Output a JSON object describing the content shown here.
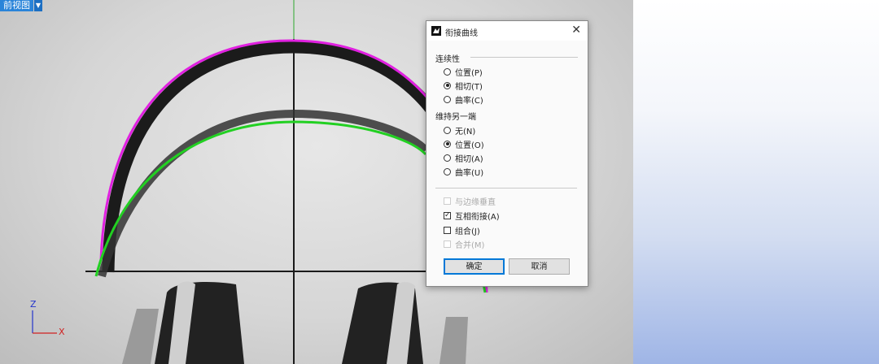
{
  "viewport": {
    "tab_label": "前视图",
    "dropdown_icon": "chevron-down-icon"
  },
  "axes": {
    "z_label": "Z",
    "x_label": "X"
  },
  "dialog": {
    "title": "衔接曲线",
    "close_glyph": "✕",
    "continuity": {
      "label": "连续性",
      "options": [
        {
          "label": "位置(P)",
          "selected": false
        },
        {
          "label": "相切(T)",
          "selected": true
        },
        {
          "label": "曲率(C)",
          "selected": false
        }
      ]
    },
    "maintain_other_end": {
      "label": "维持另一端",
      "options": [
        {
          "label": "无(N)",
          "selected": false
        },
        {
          "label": "位置(O)",
          "selected": true
        },
        {
          "label": "相切(A)",
          "selected": false
        },
        {
          "label": "曲率(U)",
          "selected": false
        }
      ]
    },
    "checkboxes": [
      {
        "label": "与边缘垂直",
        "checked": false,
        "enabled": false
      },
      {
        "label": "互相衔接(A)",
        "checked": true,
        "enabled": true
      },
      {
        "label": "组合(J)",
        "checked": false,
        "enabled": true
      },
      {
        "label": "合并(M)",
        "checked": false,
        "enabled": false
      }
    ],
    "ok_label": "确定",
    "cancel_label": "取消"
  },
  "colors": {
    "magenta_curve": "#e020e0",
    "green_curve": "#22d022",
    "accent": "#2a84d9"
  }
}
